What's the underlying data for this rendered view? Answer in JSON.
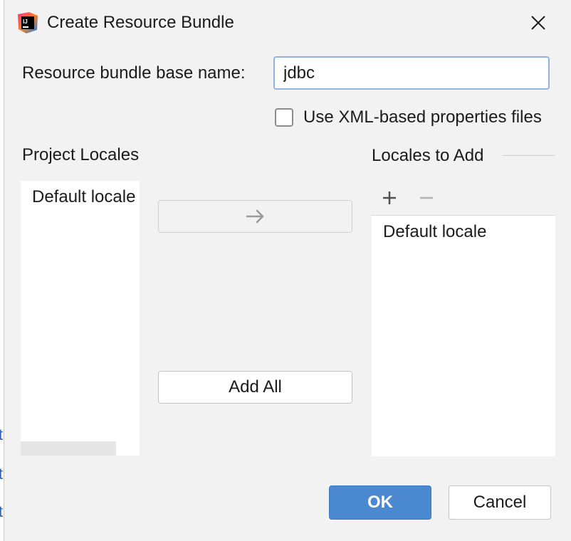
{
  "window": {
    "title": "Create Resource Bundle",
    "logo": "intellij-idea-logo",
    "close_icon": "close-icon"
  },
  "form": {
    "base_name_label": "Resource bundle base name:",
    "base_name_value": "jdbc",
    "xml_checkbox_label": "Use XML-based properties files",
    "xml_checkbox_checked": false
  },
  "project_locales": {
    "heading": "Project Locales",
    "items": [
      "Default locale"
    ]
  },
  "middle": {
    "move_icon": "arrow-right-icon",
    "move_enabled": false,
    "add_all_label": "Add All"
  },
  "locales_to_add": {
    "heading": "Locales to Add",
    "add_icon": "plus-icon",
    "remove_icon": "minus-icon",
    "items": [
      "Default locale"
    ]
  },
  "footer": {
    "ok_label": "OK",
    "cancel_label": "Cancel"
  },
  "colors": {
    "dialog_bg": "#f2f2f2",
    "primary_button": "#4a88cf",
    "input_focus_border": "#8fb4e4"
  }
}
